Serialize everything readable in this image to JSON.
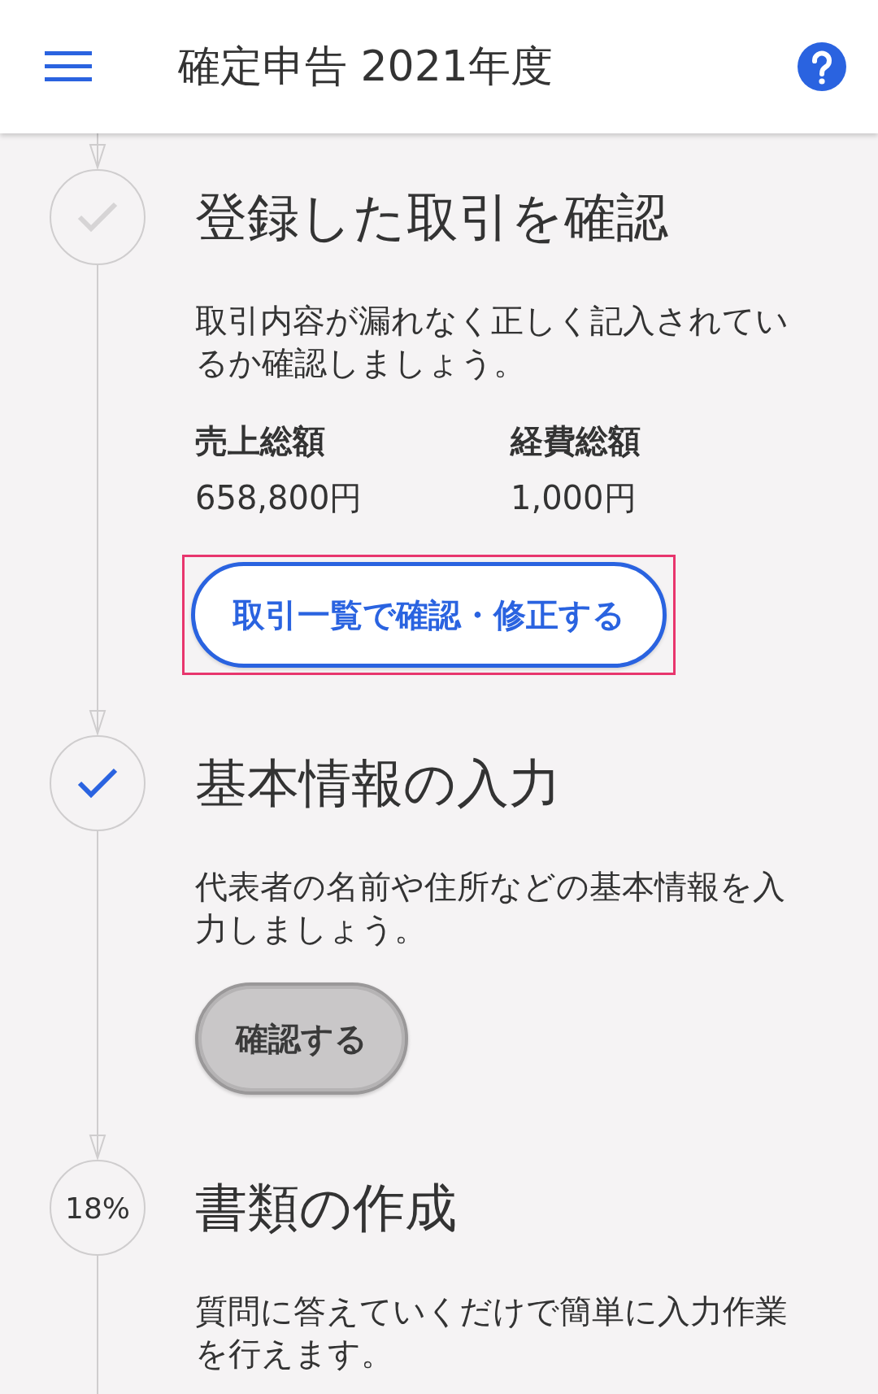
{
  "header": {
    "title": "確定申告 2021年度"
  },
  "steps": [
    {
      "kind": "check",
      "highlighted": false,
      "title": "登録した取引を確認",
      "description": "取引内容が漏れなく正しく記入されているか確認しましょう。",
      "totals": [
        {
          "label": "売上総額",
          "value": "658,800円"
        },
        {
          "label": "経費総額",
          "value": "1,000円"
        }
      ],
      "button": {
        "label": "取引一覧で確認・修正する",
        "pressed": false,
        "focused": true
      }
    },
    {
      "kind": "check",
      "highlighted": true,
      "title": "基本情報の入力",
      "description": "代表者の名前や住所などの基本情報を入力しましょう。",
      "button": {
        "label": "確認する",
        "pressed": true,
        "focused": false
      }
    },
    {
      "kind": "percent",
      "label": "18%",
      "title": "書類の作成",
      "description": "質問に答えていくだけで簡単に入力作業を行えます。"
    }
  ]
}
